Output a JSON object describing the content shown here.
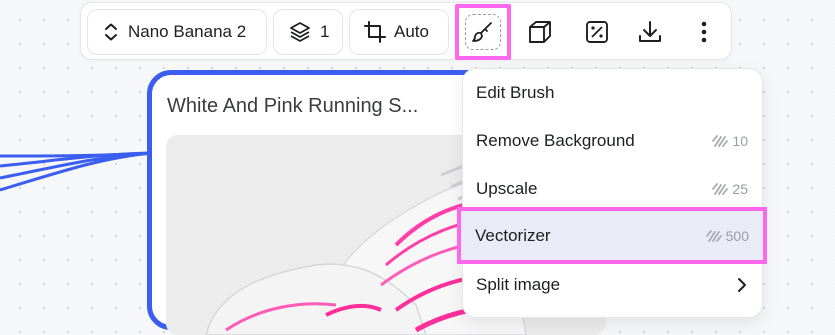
{
  "toolbar": {
    "model_label": "Nano Banana 2",
    "layers_label": "1",
    "crop_label": "Auto"
  },
  "card": {
    "title": "White And Pink Running S..."
  },
  "menu": {
    "items": [
      {
        "label": "Edit Brush",
        "cost": ""
      },
      {
        "label": "Remove Background",
        "cost": "10"
      },
      {
        "label": "Upscale",
        "cost": "25"
      },
      {
        "label": "Vectorizer",
        "cost": "500"
      },
      {
        "label": "Split image",
        "cost": ""
      }
    ]
  },
  "colors": {
    "highlight": "#ff66ee",
    "card_border": "#3b5ef0",
    "selected_row": "#e9ecf6"
  }
}
